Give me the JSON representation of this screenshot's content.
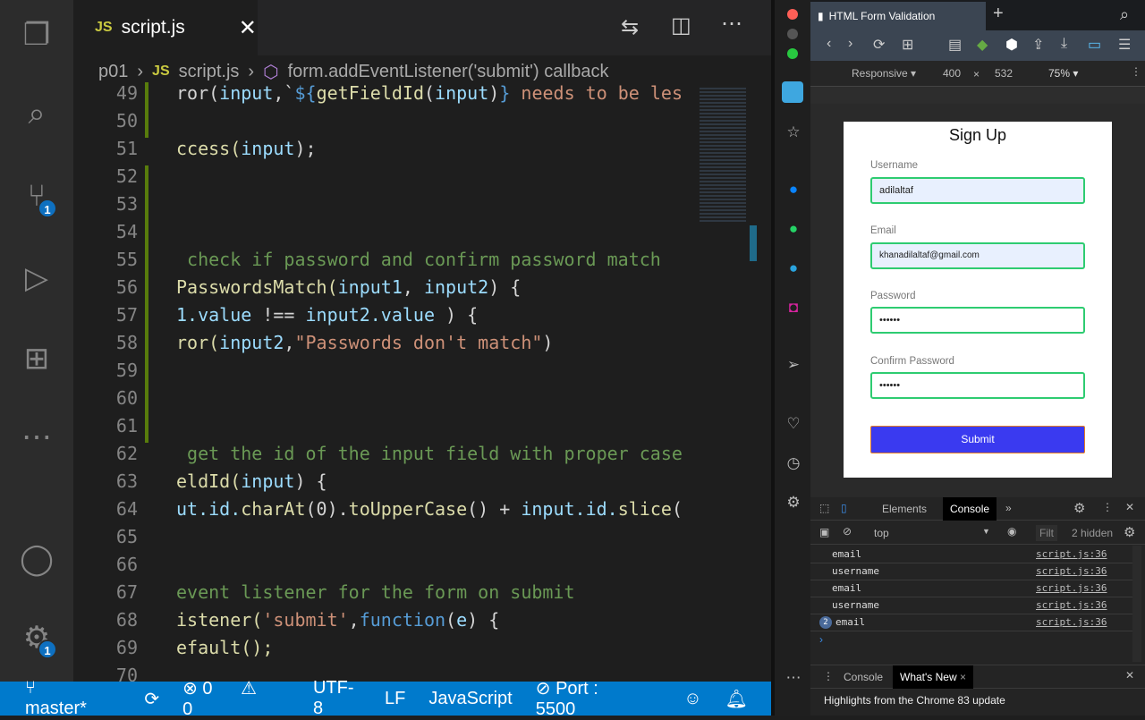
{
  "editor": {
    "tab_label": "script.js",
    "tab_lang": "JS",
    "breadcrumb": [
      "p01",
      "script.js",
      "form.addEventListener('submit') callback"
    ],
    "lines": [
      {
        "n": "49",
        "tokens": [
          [
            "ror(",
            "p"
          ],
          [
            "input",
            "v"
          ],
          [
            ",`",
            "p"
          ],
          [
            "${",
            "k"
          ],
          [
            "getFieldId",
            "f"
          ],
          [
            "(",
            "p"
          ],
          [
            "input",
            "v"
          ],
          [
            ")",
            "p"
          ],
          [
            "}",
            "k"
          ],
          [
            " needs to be les",
            "s"
          ]
        ]
      },
      {
        "n": "50",
        "tokens": []
      },
      {
        "n": "51",
        "tokens": [
          [
            "ccess(",
            "y"
          ],
          [
            "input",
            "v"
          ],
          [
            ");",
            "p"
          ]
        ]
      },
      {
        "n": "52",
        "tokens": []
      },
      {
        "n": "53",
        "tokens": []
      },
      {
        "n": "54",
        "tokens": []
      },
      {
        "n": "55",
        "tokens": [
          [
            " check if password and confirm password match",
            "c"
          ]
        ]
      },
      {
        "n": "56",
        "tokens": [
          [
            "PasswordsMatch(",
            "y"
          ],
          [
            "input1",
            "v"
          ],
          [
            ", ",
            "p"
          ],
          [
            "input2",
            "v"
          ],
          [
            ") {",
            "p"
          ]
        ]
      },
      {
        "n": "57",
        "tokens": [
          [
            "1.value",
            "v"
          ],
          [
            " !== ",
            "p"
          ],
          [
            "input2.value",
            "v"
          ],
          [
            " ) {",
            "p"
          ]
        ]
      },
      {
        "n": "58",
        "tokens": [
          [
            "ror(",
            "y"
          ],
          [
            "input2",
            "v"
          ],
          [
            ",",
            "p"
          ],
          [
            "\"Passwords don't match\"",
            "s"
          ],
          [
            ")",
            "p"
          ]
        ]
      },
      {
        "n": "59",
        "tokens": []
      },
      {
        "n": "60",
        "tokens": []
      },
      {
        "n": "61",
        "tokens": []
      },
      {
        "n": "62",
        "tokens": [
          [
            " get the id of the input field with proper case",
            "c"
          ]
        ]
      },
      {
        "n": "63",
        "tokens": [
          [
            "eldId(",
            "y"
          ],
          [
            "input",
            "v"
          ],
          [
            ") {",
            "p"
          ]
        ]
      },
      {
        "n": "64",
        "tokens": [
          [
            "ut.id.",
            "v"
          ],
          [
            "charAt",
            "f"
          ],
          [
            "(0).",
            "p"
          ],
          [
            "toUpperCase",
            "f"
          ],
          [
            "() + ",
            "p"
          ],
          [
            "input.id.",
            "v"
          ],
          [
            "slice",
            "f"
          ],
          [
            "(",
            "p"
          ]
        ]
      },
      {
        "n": "65",
        "tokens": []
      },
      {
        "n": "66",
        "tokens": []
      },
      {
        "n": "67",
        "tokens": [
          [
            "event listener for the form on submit",
            "c"
          ]
        ]
      },
      {
        "n": "68",
        "tokens": [
          [
            "istener(",
            "y"
          ],
          [
            "'submit'",
            "s"
          ],
          [
            ",",
            "p"
          ],
          [
            "function",
            "k"
          ],
          [
            "(",
            "p"
          ],
          [
            "e",
            "v"
          ],
          [
            ") {",
            "p"
          ]
        ]
      },
      {
        "n": "69",
        "tokens": [
          [
            "efault();",
            "y"
          ]
        ]
      },
      {
        "n": "70",
        "tokens": []
      }
    ],
    "scm_badge": "1",
    "settings_badge": "1"
  },
  "status": {
    "branch": "master*",
    "errors": "0",
    "warnings": "0",
    "encoding": "UTF-8",
    "eol": "LF",
    "language": "JavaScript",
    "port": "Port : 5500"
  },
  "browser": {
    "tab_title": "HTML Form Validation",
    "device": "Responsive ▾",
    "width": "400",
    "x": "×",
    "height": "532",
    "zoom": "75% ▾"
  },
  "form": {
    "title": "Sign Up",
    "fields": [
      {
        "label": "Username",
        "value": "adilaltaf"
      },
      {
        "label": "Email",
        "value": "khanadilaltaf@gmail.com"
      },
      {
        "label": "Password",
        "value": "••••••"
      },
      {
        "label": "Confirm Password",
        "value": "••••••"
      }
    ],
    "submit": "Submit"
  },
  "devtools": {
    "tabs": [
      "Elements",
      "Console",
      "»"
    ],
    "context": "top",
    "filter_placeholder": "Filt",
    "hidden": "2 hidden",
    "logs": [
      {
        "msg": "email",
        "src": "script.js:36"
      },
      {
        "msg": "username",
        "src": "script.js:36"
      },
      {
        "msg": "email",
        "src": "script.js:36"
      },
      {
        "msg": "username",
        "src": "script.js:36"
      },
      {
        "count": "2",
        "msg": "email",
        "src": "script.js:36"
      }
    ],
    "prompt": "›",
    "drawer_tabs": [
      "Console",
      "What's New"
    ],
    "drawer_text": "Highlights from the Chrome 83 update"
  }
}
